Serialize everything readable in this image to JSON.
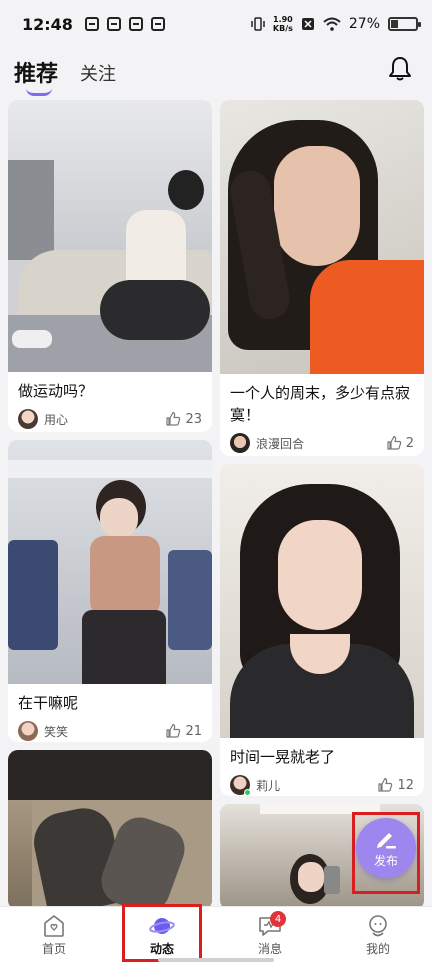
{
  "status_bar": {
    "time": "12:48",
    "net_speed_value": "1.90",
    "net_speed_unit": "KB/s",
    "battery": "27%"
  },
  "header": {
    "tabs": [
      {
        "label": "推荐",
        "active": true
      },
      {
        "label": "关注",
        "active": false
      }
    ],
    "bell_icon": "bell-icon"
  },
  "feed": {
    "posts": [
      {
        "title": "做运动吗？",
        "author": "用心",
        "likes": "23"
      },
      {
        "title": "一个人的周末，多少有点寂寞！",
        "author": "浪漫回合",
        "likes": "2"
      },
      {
        "title": "在干嘛呢",
        "author": "笑笑",
        "likes": "21"
      },
      {
        "title": "时间一晃就老了",
        "author": "莉儿",
        "likes": "12"
      }
    ]
  },
  "publish": {
    "label": "发布",
    "icon": "pen-icon"
  },
  "bottom_nav": {
    "items": [
      {
        "label": "首页",
        "icon": "home-icon"
      },
      {
        "label": "动态",
        "icon": "planet-icon",
        "active": true
      },
      {
        "label": "消息",
        "icon": "message-icon",
        "badge": "4"
      },
      {
        "label": "我的",
        "icon": "profile-icon"
      }
    ]
  },
  "colors": {
    "accent": "#7b6cf0",
    "publish": "#9d86ee",
    "highlight": "#d81e1e",
    "badge": "#e0343c"
  }
}
